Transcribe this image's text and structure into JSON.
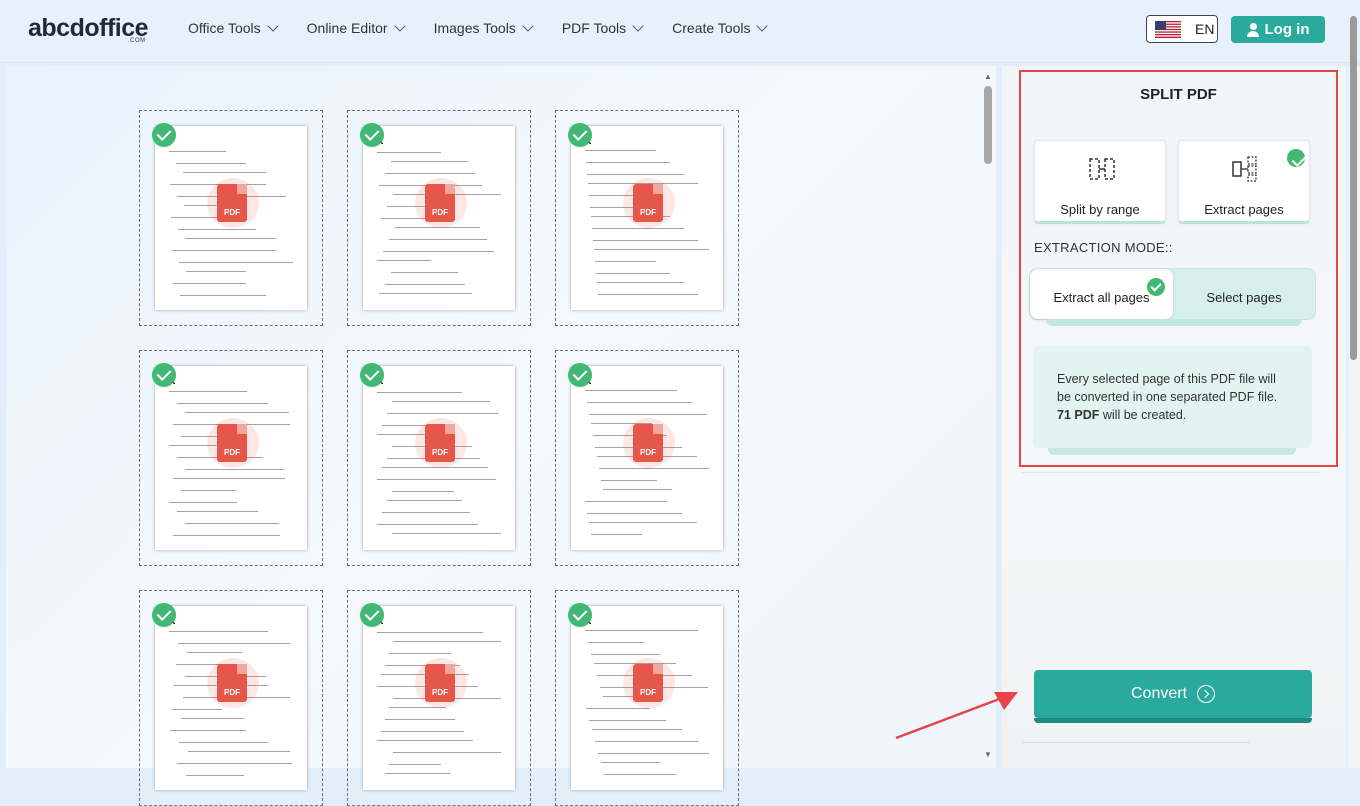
{
  "header": {
    "logo": "abcdoffice",
    "logo_sub": ".COM",
    "nav": [
      "Office Tools",
      "Online Editor",
      "Images Tools",
      "PDF Tools",
      "Create Tools"
    ],
    "lang": "EN",
    "login": "Log in"
  },
  "thumbnails": {
    "pdf_label": "PDF"
  },
  "panel": {
    "title": "SPLIT PDF",
    "modes": [
      "Split by range",
      "Extract pages"
    ],
    "extraction_label": "EXTRACTION MODE::",
    "toggle": [
      "Extract all pages",
      "Select pages"
    ],
    "info_line1": "Every selected page of this PDF file will be converted in one separated PDF file.",
    "info_count": "71 PDF",
    "info_line2": "will be created.",
    "convert": "Convert"
  },
  "colors": {
    "accent": "#2aa99d",
    "check": "#41b873",
    "highlight": "#e8424b",
    "pdf": "#e4554a"
  }
}
